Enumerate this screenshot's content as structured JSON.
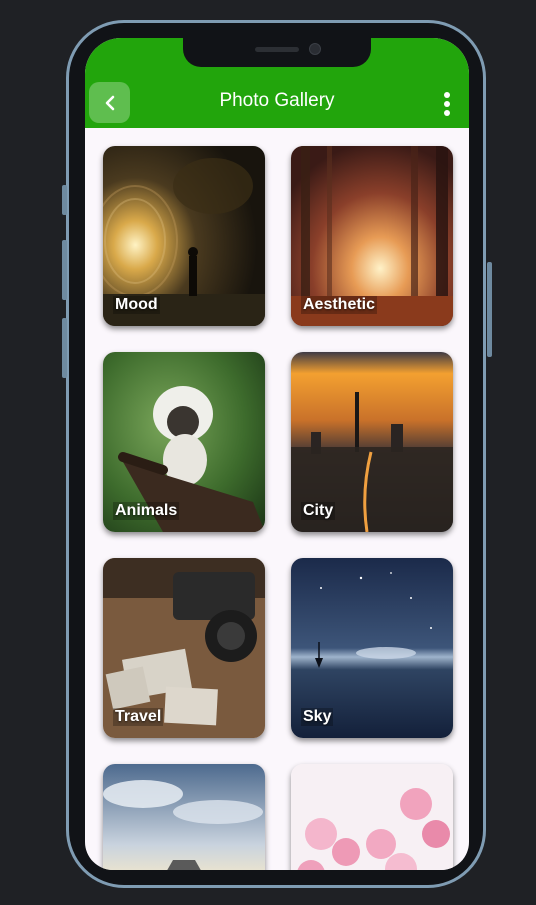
{
  "app": {
    "title": "Photo Gallery",
    "accent_color": "#22a50c",
    "back_icon": "chevron-left-icon",
    "menu_icon": "more-vertical-icon"
  },
  "categories": [
    {
      "label": "Mood",
      "image": "mood-tunnel-photo"
    },
    {
      "label": "Aesthetic",
      "image": "aesthetic-forest-photo"
    },
    {
      "label": "Animals",
      "image": "animals-monkey-photo"
    },
    {
      "label": "City",
      "image": "city-skyline-photo"
    },
    {
      "label": "Travel",
      "image": "travel-camera-photo"
    },
    {
      "label": "Sky",
      "image": "sky-night-photo"
    },
    {
      "label": "",
      "image": "road-clouds-photo"
    },
    {
      "label": "",
      "image": "pink-flowers-photo"
    }
  ]
}
